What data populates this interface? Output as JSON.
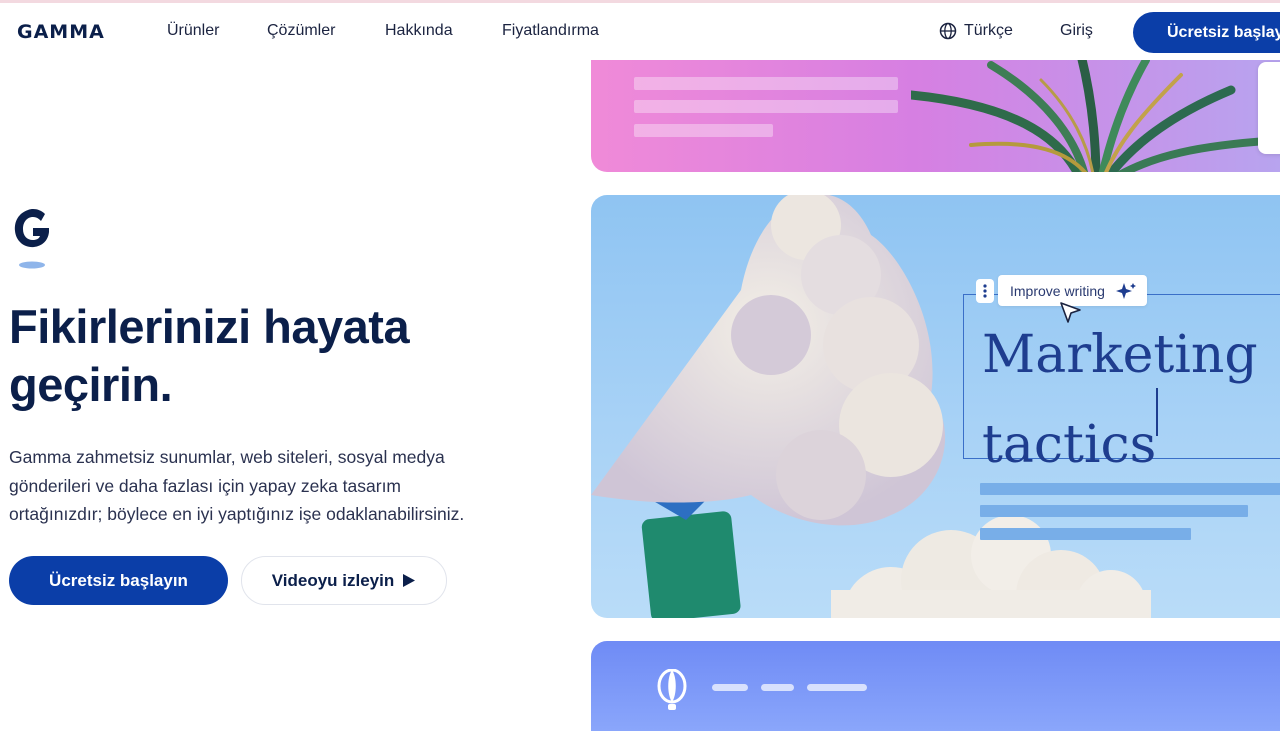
{
  "nav": {
    "logo": "GAMMA",
    "links": [
      "Ürünler",
      "Çözümler",
      "Hakkında",
      "Fiyatlandırma"
    ],
    "language": "Türkçe",
    "login": "Giriş",
    "cta": "Ücretsiz başlayın"
  },
  "hero": {
    "title_lines": [
      "Fikirlerinizi hayata",
      "geçirin."
    ],
    "subtitle_lines": [
      "Gamma zahmetsiz sunumlar, web siteleri, sosyal medya",
      "gönderileri ve daha fazlası için yapay zeka tasarım",
      "ortağınızdır; böylece en iyi yaptığınız işe odaklanabilirsiniz."
    ],
    "primary_button": "Ücretsiz başlayın",
    "secondary_button": "Videoyu izleyin"
  },
  "preview": {
    "ai_action": "Improve writing",
    "heading_lines": [
      "Marketing",
      "tactics"
    ]
  },
  "colors": {
    "brand": "#0b3ea8",
    "text": "#0b1f4a"
  }
}
